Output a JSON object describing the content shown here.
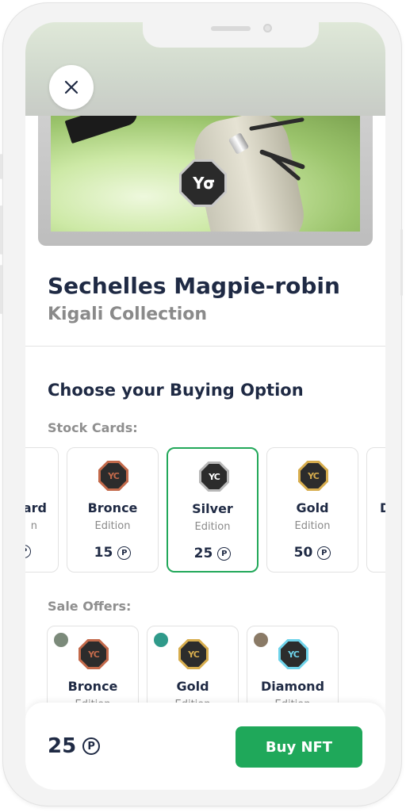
{
  "nft": {
    "title": "Sechelles Magpie-robin",
    "collection": "Kigali Collection"
  },
  "section_title": "Choose your Buying Option",
  "stock_label": "Stock Cards:",
  "stock_cards": [
    {
      "name": "ard",
      "edition": "n",
      "price": "",
      "badge_color": "#ffffff",
      "selected": false
    },
    {
      "name": "Bronce",
      "edition": "Edition",
      "price": "15",
      "badge_color": "#c36a4b",
      "selected": false
    },
    {
      "name": "Silver",
      "edition": "Edition",
      "price": "25",
      "badge_color": "#b8b8b8",
      "selected": true
    },
    {
      "name": "Gold",
      "edition": "Edition",
      "price": "50",
      "badge_color": "#d7ad4e",
      "selected": false
    },
    {
      "name": "D",
      "edition": "",
      "price": "",
      "badge_color": "#ffffff",
      "selected": false
    }
  ],
  "sale_label": "Sale Offers:",
  "sale_offers": [
    {
      "name": "Bronce",
      "edition": "Edition",
      "badge_color": "#c36a4b",
      "avatar_color": "#7b8a7a"
    },
    {
      "name": "Gold",
      "edition": "Edition",
      "badge_color": "#d7ad4e",
      "avatar_color": "#2f9a8a"
    },
    {
      "name": "Diamond",
      "edition": "Edition",
      "badge_color": "#6fd3ea",
      "avatar_color": "#8a7a66"
    }
  ],
  "bottom": {
    "total": "25",
    "buy_label": "Buy NFT"
  },
  "colors": {
    "accent": "#1fa85a",
    "text_dark": "#1f2a44",
    "text_muted": "#8a8a8a"
  },
  "icons": {
    "close": "close-icon",
    "coin": "coin-icon",
    "brand": "brand-logo-badge"
  }
}
